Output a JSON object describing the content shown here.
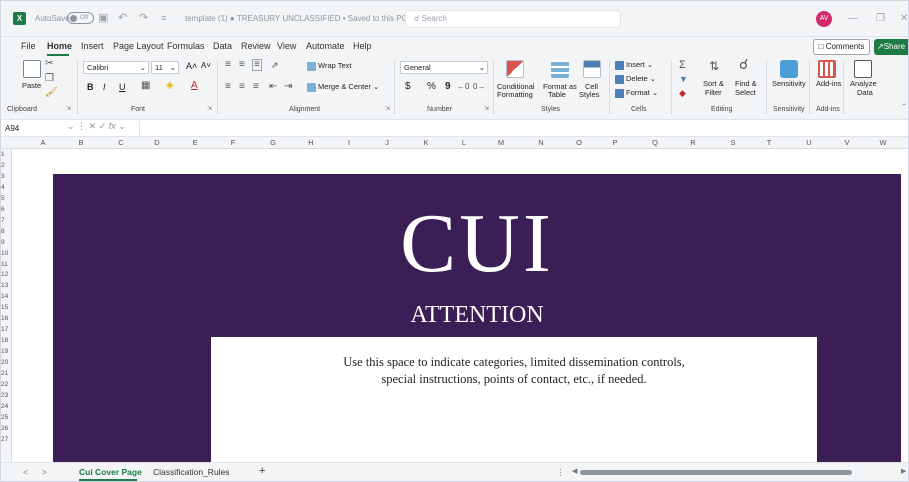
{
  "titlebar": {
    "autosave_label": "AutoSave",
    "autosave_state": "Off",
    "doc_title": "template (1) ● TREASURY UNCLASSIFIED • Saved to this PC ∨",
    "search_placeholder": "Search",
    "avatar_initials": "AV"
  },
  "menu": {
    "items": [
      "File",
      "Home",
      "Insert",
      "Page Layout",
      "Formulas",
      "Data",
      "Review",
      "View",
      "Automate",
      "Help"
    ],
    "comments_label": "Comments",
    "share_label": "Share"
  },
  "ribbon": {
    "clipboard": {
      "paste": "Paste",
      "label": "Clipboard"
    },
    "font": {
      "name": "Calibri",
      "size": "11",
      "bold": "B",
      "italic": "I",
      "underline": "U",
      "grow": "A˄",
      "shrink": "A˅",
      "color": "A",
      "label": "Font"
    },
    "alignment": {
      "wrap_text": "Wrap Text",
      "merge_center": "Merge & Center",
      "label": "Alignment"
    },
    "number": {
      "format": "General",
      "currency": "$",
      "percent": "%",
      "comma": "9",
      "label": "Number"
    },
    "styles": {
      "conditional": "Conditional",
      "formatting": "Formatting",
      "format_as": "Format as",
      "table": "Table",
      "cell": "Cell",
      "styles_btn": "Styles",
      "label": "Styles"
    },
    "cells": {
      "insert": "Insert",
      "delete": "Delete",
      "format": "Format",
      "label": "Cells"
    },
    "editing": {
      "sort": "Sort &",
      "filter": "Filter",
      "find": "Find &",
      "select": "Select",
      "label": "Editing"
    },
    "sensitivity": {
      "button": "Sensitivity",
      "label": "Sensitivity"
    },
    "addins": {
      "button": "Add-ins",
      "label": "Add-ins"
    },
    "analyze": {
      "line1": "Analyze",
      "line2": "Data"
    }
  },
  "formula_bar": {
    "name_box": "A94",
    "fx": "fx",
    "value": ""
  },
  "columns": [
    "A",
    "B",
    "C",
    "D",
    "E",
    "F",
    "G",
    "H",
    "I",
    "J",
    "K",
    "L",
    "M",
    "N",
    "O",
    "P",
    "Q",
    "R",
    "S",
    "T",
    "U",
    "V",
    "W"
  ],
  "rows": [
    "1",
    "2",
    "3",
    "4",
    "5",
    "6",
    "7",
    "8",
    "9",
    "10",
    "11",
    "12",
    "13",
    "14",
    "15",
    "16",
    "17",
    "18",
    "19",
    "20",
    "21",
    "22",
    "23",
    "24",
    "25",
    "26",
    "27"
  ],
  "cover": {
    "title": "CUI",
    "attention": "ATTENTION",
    "line1": "Use this space to indicate categories, limited dissemination controls,",
    "line2": "special instructions, points of contact, etc., if needed.",
    "background_color": "#3b1e55"
  },
  "tabs": {
    "items": [
      "Cui Cover Page",
      "Classification_Rules"
    ],
    "active": "Cui Cover Page",
    "add": "+"
  },
  "colors": {
    "accent": "#1f7b45",
    "banner": "#3b1e55"
  }
}
